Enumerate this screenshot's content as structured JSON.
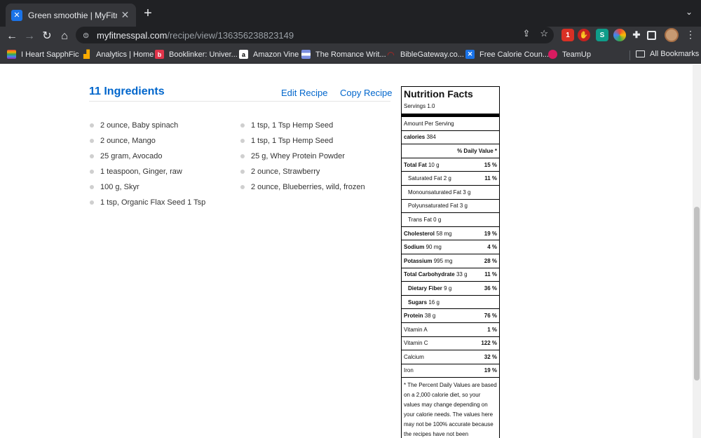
{
  "browser": {
    "tab_title": "Green smoothie | MyFitnessPal",
    "url_host": "myfitnesspal.com",
    "url_path": "/recipe/view/136356238823149",
    "extension_badge": "1",
    "bookmarks": [
      {
        "label": "I Heart SapphFic",
        "icon": "rainbow-flag-icon",
        "color": "#e8423b"
      },
      {
        "label": "Analytics | Home",
        "icon": "analytics-bars-icon",
        "color": "#f9ab00"
      },
      {
        "label": "Booklinker: Univer...",
        "icon": "booklinker-b-icon",
        "color": "#e0344a"
      },
      {
        "label": "Amazon Vine",
        "icon": "amazon-a-icon",
        "color": "#ffffff"
      },
      {
        "label": "The Romance Writ...",
        "icon": "romance-writers-icon",
        "color": "#7b8fe0"
      },
      {
        "label": "BibleGateway.co...",
        "icon": "biblegateway-icon",
        "color": "#8a2a2a"
      },
      {
        "label": "Free Calorie Coun...",
        "icon": "myfitnesspal-icon",
        "color": "#1a73e8"
      },
      {
        "label": "TeamUp",
        "icon": "teamup-icon",
        "color": "#d81b60"
      }
    ],
    "all_bookmarks": "All Bookmarks"
  },
  "ingredients": {
    "heading": "11 Ingredients",
    "edit_label": "Edit Recipe",
    "copy_label": "Copy Recipe",
    "column1": [
      "2 ounce, Baby spinach",
      "2 ounce, Mango",
      "25 gram, Avocado",
      "1 teaspoon, Ginger, raw",
      "100 g, Skyr",
      "1 tsp, Organic Flax Seed 1 Tsp"
    ],
    "column2": [
      "1 tsp, 1 Tsp Hemp Seed",
      "1 tsp, 1 Tsp Hemp Seed",
      "25 g, Whey Protein Powder",
      "2 ounce, Strawberry",
      "2 ounce, Blueberries, wild, frozen"
    ]
  },
  "nutrition": {
    "title": "Nutrition Facts",
    "servings": "Servings 1.0",
    "amount_per_serving": "Amount Per Serving",
    "calories_label": "calories",
    "calories_value": "384",
    "daily_value_header": "% Daily Value *",
    "rows": [
      {
        "label": "Total Fat",
        "amount": "10 g",
        "pct": "15 %",
        "bold": true,
        "indent": false
      },
      {
        "label": "Saturated Fat",
        "amount": "2 g",
        "pct": "11 %",
        "bold": false,
        "indent": true
      },
      {
        "label": "Monounsaturated Fat",
        "amount": "3 g",
        "pct": "",
        "bold": false,
        "indent": true
      },
      {
        "label": "Polyunsaturated Fat",
        "amount": "3 g",
        "pct": "",
        "bold": false,
        "indent": true
      },
      {
        "label": "Trans Fat",
        "amount": "0 g",
        "pct": "",
        "bold": false,
        "indent": true
      },
      {
        "label": "Cholesterol",
        "amount": "58 mg",
        "pct": "19 %",
        "bold": true,
        "indent": false
      },
      {
        "label": "Sodium",
        "amount": "90 mg",
        "pct": "4 %",
        "bold": true,
        "indent": false
      },
      {
        "label": "Potassium",
        "amount": "995 mg",
        "pct": "28 %",
        "bold": true,
        "indent": false
      },
      {
        "label": "Total Carbohydrate",
        "amount": "33 g",
        "pct": "11 %",
        "bold": true,
        "indent": false
      },
      {
        "label": "Dietary Fiber",
        "amount": "9 g",
        "pct": "36 %",
        "bold": true,
        "indent": true
      },
      {
        "label": "Sugars",
        "amount": "16 g",
        "pct": "",
        "bold": true,
        "indent": true
      },
      {
        "label": "Protein",
        "amount": "38 g",
        "pct": "76 %",
        "bold": true,
        "indent": false
      },
      {
        "label": "Vitamin A",
        "amount": "",
        "pct": "1 %",
        "bold": false,
        "indent": false
      },
      {
        "label": "Vitamin C",
        "amount": "",
        "pct": "122 %",
        "bold": false,
        "indent": false
      },
      {
        "label": "Calcium",
        "amount": "",
        "pct": "32 %",
        "bold": false,
        "indent": false
      },
      {
        "label": "Iron",
        "amount": "",
        "pct": "19 %",
        "bold": false,
        "indent": false
      }
    ],
    "footnote": "* The Percent Daily Values are based on a 2,000 calorie diet, so your values may change depending on your calorie needs. The values here may not be 100% accurate because the recipes have not been professionally"
  }
}
